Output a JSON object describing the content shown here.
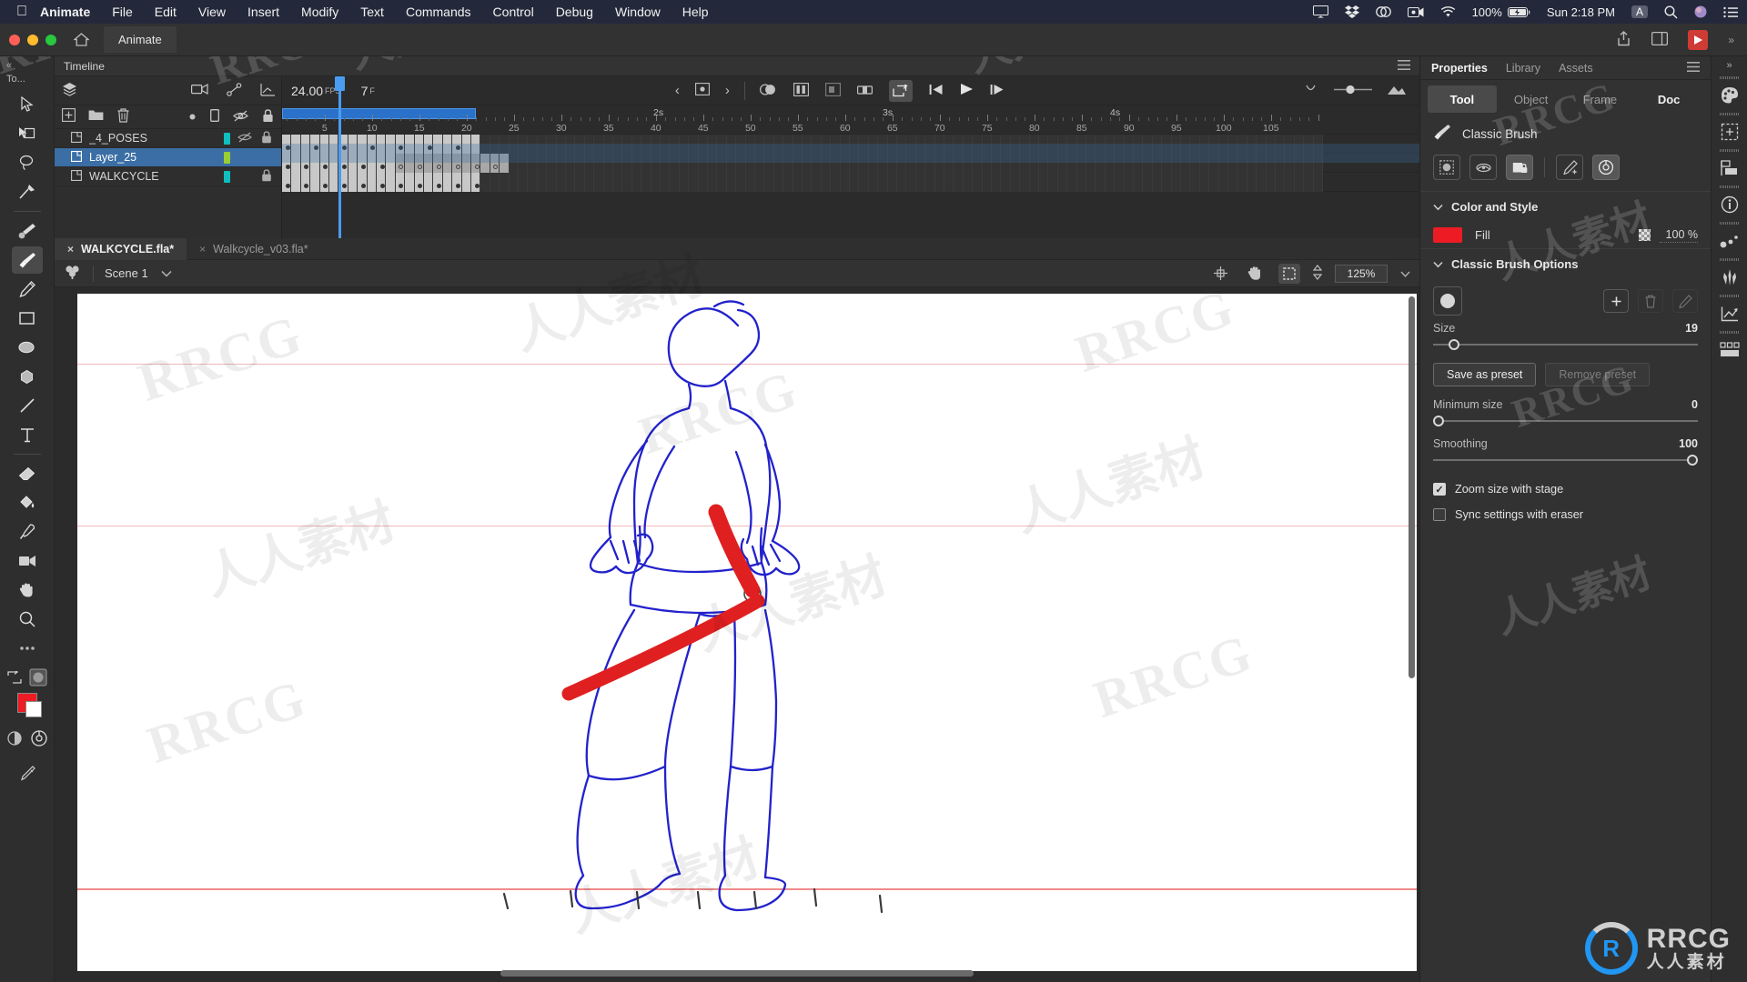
{
  "mac_menu": {
    "apple": "apple-logo",
    "items": [
      {
        "label": "Animate",
        "bold": true
      },
      {
        "label": "File"
      },
      {
        "label": "Edit"
      },
      {
        "label": "View"
      },
      {
        "label": "Insert"
      },
      {
        "label": "Modify"
      },
      {
        "label": "Text"
      },
      {
        "label": "Commands"
      },
      {
        "label": "Control"
      },
      {
        "label": "Debug"
      },
      {
        "label": "Window"
      },
      {
        "label": "Help"
      }
    ],
    "status": {
      "battery_percent": "100%",
      "clock": "Sun 2:18 PM",
      "input_source": "A",
      "icons": [
        "airplay-icon",
        "dropbox-icon",
        "creative-cloud-icon",
        "screen-record-icon",
        "wifi-icon",
        "battery-icon",
        "spotlight-search-icon",
        "siri-icon",
        "control-center-icon"
      ]
    }
  },
  "titlebar": {
    "app_tab": "Animate",
    "home_icon": "home-icon",
    "share_icon": "share-icon",
    "layout_icon": "workspace-icon",
    "play_icon": "test-movie-icon"
  },
  "tools_panel": {
    "collapse": "«",
    "label": "To...",
    "items": [
      {
        "name": "selection-tool",
        "icon": "arrow"
      },
      {
        "name": "free-transform-tool",
        "icon": "transform"
      },
      {
        "name": "lasso-tool",
        "icon": "lasso"
      },
      {
        "name": "bone-tool",
        "icon": "pin"
      },
      {
        "name": "fluid-brush-tool",
        "icon": "fluidbrush"
      },
      {
        "name": "classic-brush-tool",
        "icon": "brush",
        "selected": true
      },
      {
        "name": "pencil-tool",
        "icon": "pencil"
      },
      {
        "name": "rectangle-tool",
        "icon": "rect"
      },
      {
        "name": "oval-tool",
        "icon": "oval"
      },
      {
        "name": "polystar-tool",
        "icon": "poly"
      },
      {
        "name": "line-tool",
        "icon": "line"
      },
      {
        "name": "text-tool",
        "icon": "text"
      },
      {
        "name": "eraser-tool",
        "icon": "eraser"
      },
      {
        "name": "paint-bucket-tool",
        "icon": "bucket"
      },
      {
        "name": "eyedropper-tool",
        "icon": "dropper"
      },
      {
        "name": "camera-tool",
        "icon": "camera"
      },
      {
        "name": "hand-tool",
        "icon": "hand"
      },
      {
        "name": "zoom-tool",
        "icon": "zoom"
      },
      {
        "name": "more-tools",
        "icon": "ellipsis"
      }
    ],
    "colors": {
      "fill": "#ed1c24",
      "stroke": "#ffffff"
    }
  },
  "timeline": {
    "title": "Timeline",
    "fps": "24.00",
    "fps_unit": "FPS",
    "current_frame": "7",
    "frame_unit": "F",
    "header_icons": [
      "add-layer-icon",
      "new-folder-icon",
      "delete-layer-icon"
    ],
    "column_icons": [
      "keyframe-dot-icon",
      "outline-icon",
      "eye-icon",
      "lock-icon"
    ],
    "toolbar_icons": [
      "camera-icon",
      "layer-depth-icon",
      "prev-keyframe-icon",
      "insert-keyframe-icon",
      "next-keyframe-icon",
      "onion-skin-icon",
      "onion-outline-icon",
      "edit-multiple-icon",
      "loop-range-icon",
      "loop-playback-icon",
      "step-back-icon",
      "play-icon",
      "step-forward-icon"
    ],
    "right_icons": [
      "resize-frames-icon",
      "zoom-slider-icon",
      "preview-icon"
    ],
    "layers": [
      {
        "name": "_4_POSES",
        "color": "#0fbfbf",
        "visible": false,
        "locked": true,
        "selected": false
      },
      {
        "name": "Layer_25",
        "color": "#9acd32",
        "visible": true,
        "locked": false,
        "selected": true
      },
      {
        "name": "WALKCYCLE",
        "color": "#0fbfbf",
        "visible": true,
        "locked": true,
        "selected": false
      }
    ],
    "ruler": {
      "ticks": [
        5,
        10,
        15,
        20,
        25,
        30,
        35,
        40,
        45,
        50,
        55,
        60,
        65,
        70,
        75,
        80,
        85,
        90,
        95,
        100,
        105
      ],
      "second_marks": [
        {
          "label": "2s",
          "frame": 48
        },
        {
          "label": "3s",
          "frame": 72
        },
        {
          "label": "4s",
          "frame": 96
        }
      ],
      "range_start": 1,
      "range_end": 24,
      "playhead_frame": 7
    }
  },
  "doc_tabs": [
    {
      "label": "WALKCYCLE.fla*",
      "active": true,
      "close": "×"
    },
    {
      "label": "Walkcycle_v03.fla*",
      "active": false,
      "close": "×"
    }
  ],
  "scene_bar": {
    "symbol_icon": "scene-symbol-icon",
    "scene": "Scene 1",
    "chevron": "⌄",
    "zoom": "125%",
    "buttons": [
      "clip-content-icon",
      "pan-stage-icon",
      "fit-stage-icon"
    ]
  },
  "stage": {
    "artwork": "walk-cycle-character-drawing",
    "guides_color": "#ef8a8a",
    "drawing_stroke": "#2222cc",
    "brush_stroke": "#e02020"
  },
  "properties": {
    "panel_tabs": [
      {
        "label": "Properties",
        "active": true
      },
      {
        "label": "Library",
        "active": false
      },
      {
        "label": "Assets",
        "active": false
      }
    ],
    "menu_icon": "panel-menu-icon",
    "segments": [
      {
        "label": "Tool",
        "active": true
      },
      {
        "label": "Object",
        "active": false
      },
      {
        "label": "Frame",
        "active": false
      },
      {
        "label": "Doc",
        "active": false,
        "bright": true
      }
    ],
    "tool_name": "Classic Brush",
    "tool_icon": "brush-icon",
    "option_icons": [
      {
        "name": "object-drawing-icon",
        "on": false
      },
      {
        "name": "brush-mode-icon",
        "on": false
      },
      {
        "name": "lock-fill-icon",
        "on": true
      },
      {
        "name": "smooth-icon",
        "on": false
      },
      {
        "name": "paint-selection-icon",
        "on": true
      }
    ],
    "color_and_style": {
      "title": "Color and Style",
      "chevron": "⌄",
      "fill_label": "Fill",
      "fill_color": "#ed1c24",
      "alpha_label": "100 %",
      "alpha_icon": "transparency-checker-icon"
    },
    "brush_options": {
      "title": "Classic Brush Options",
      "chevron": "⌄",
      "preset_icon": "brush-preset-icon",
      "add_icon": "add-preset-icon",
      "delete_icon": "delete-preset-icon",
      "edit_icon": "edit-preset-icon",
      "size_label": "Size",
      "size_value": "19",
      "size_pct": 6,
      "save_preset": "Save as preset",
      "remove_preset": "Remove preset",
      "min_size_label": "Minimum size",
      "min_size_value": "0",
      "min_size_pct": 0,
      "smoothing_label": "Smoothing",
      "smoothing_value": "100",
      "smoothing_pct": 100,
      "zoom_with_stage": {
        "label": "Zoom size with stage",
        "checked": true,
        "mark": "✓"
      },
      "sync_eraser": {
        "label": "Sync settings with eraser",
        "checked": false,
        "mark": ""
      }
    }
  },
  "right_rail": {
    "collapse": "»",
    "icons": [
      "color-palette-icon",
      "align-panel-icon",
      "transform-panel-icon",
      "info-panel-icon",
      "motion-presets-icon",
      "brush-library-icon",
      "graph-editor-icon",
      "components-icon"
    ]
  },
  "watermarks": {
    "brand": "RRCG",
    "chinese": "人人素材",
    "logo_text": "RRCG",
    "logo_sub": "人人素材"
  }
}
